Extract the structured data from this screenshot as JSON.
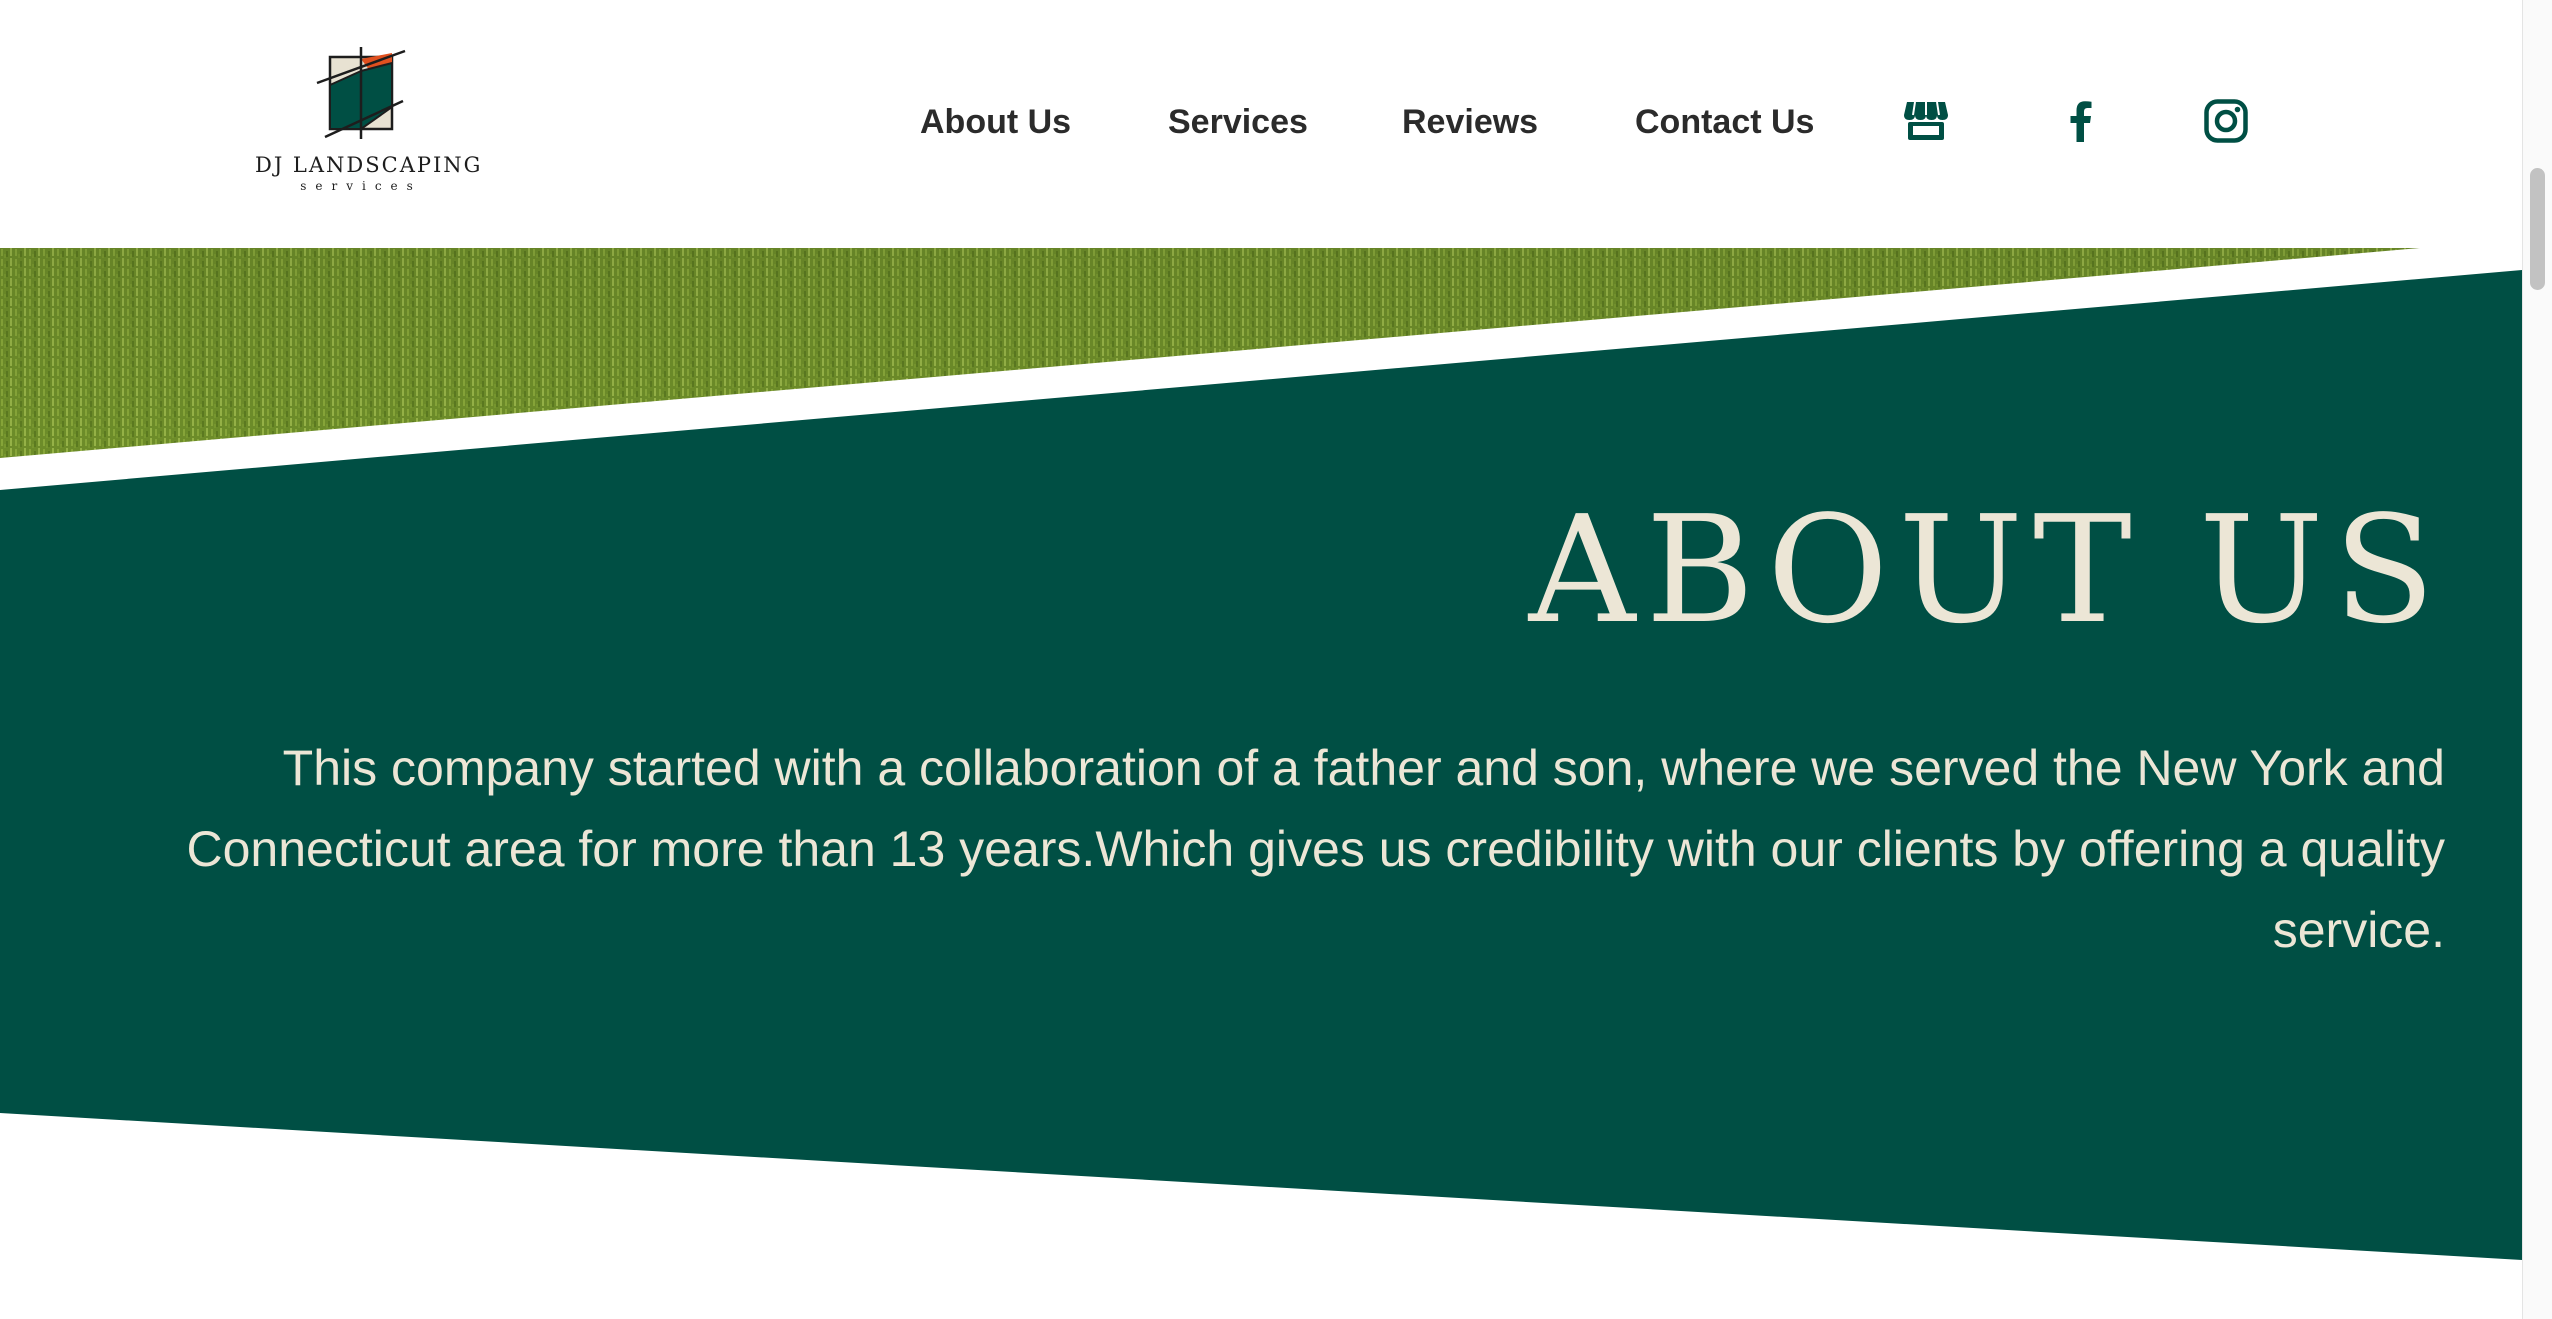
{
  "colors": {
    "brand_green": "#004f44",
    "cream": "#ece6d6",
    "accent_orange": "#e0501f",
    "nav_text": "#2b2b2b"
  },
  "logo": {
    "name": "DJ LANDSCAPING",
    "subtitle": "services"
  },
  "nav": {
    "items": [
      {
        "label": "About Us"
      },
      {
        "label": "Services"
      },
      {
        "label": "Reviews"
      },
      {
        "label": "Contact Us"
      }
    ],
    "icons": [
      "storefront-icon",
      "facebook-icon",
      "instagram-icon"
    ]
  },
  "about": {
    "title": "ABOUT US",
    "body": "This company started with a collaboration of a father and son, where we served the New York and Connecticut area for more than 13 years.Which gives us credibility with our clients by offering a quality service."
  }
}
